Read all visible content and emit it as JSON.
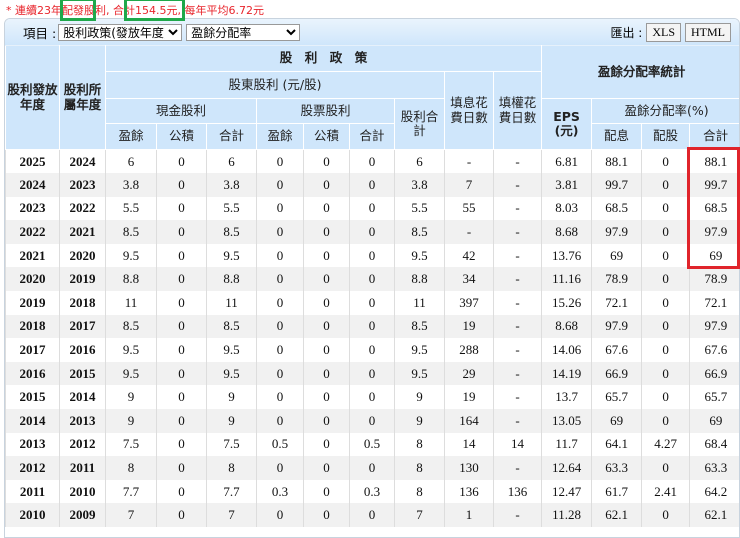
{
  "note": "* 連續23年配發股利, 合計154.5元, 每年平均6.72元",
  "toolbar": {
    "item_label": "項目 :",
    "select1": "股利政策(發放年度)",
    "select2": "盈餘分配率",
    "export_label": "匯出 :",
    "xls": "XLS",
    "html": "HTML"
  },
  "headers": {
    "pay_year": "股利發放年度",
    "belong_year": "股利所屬年度",
    "policy": "股　利　政　策",
    "holder_div": "股東股利 (元/股)",
    "cash": "現金股利",
    "stock": "股票股利",
    "earn": "盈餘",
    "reserve": "公積",
    "total": "合計",
    "div_total": "股利合計",
    "fill_div": "填息花費日數",
    "fill_right": "填權花費日數",
    "stats": "盈餘分配率統計",
    "eps": "EPS (元)",
    "ratio": "盈餘分配率(%)",
    "r_cash": "配息",
    "r_stock": "配股",
    "r_total": "合計"
  },
  "rows": [
    [
      "2025",
      "2024",
      "6",
      "0",
      "6",
      "0",
      "0",
      "0",
      "6",
      "-",
      "-",
      "6.81",
      "88.1",
      "0",
      "88.1"
    ],
    [
      "2024",
      "2023",
      "3.8",
      "0",
      "3.8",
      "0",
      "0",
      "0",
      "3.8",
      "7",
      "-",
      "3.81",
      "99.7",
      "0",
      "99.7"
    ],
    [
      "2023",
      "2022",
      "5.5",
      "0",
      "5.5",
      "0",
      "0",
      "0",
      "5.5",
      "55",
      "-",
      "8.03",
      "68.5",
      "0",
      "68.5"
    ],
    [
      "2022",
      "2021",
      "8.5",
      "0",
      "8.5",
      "0",
      "0",
      "0",
      "8.5",
      "-",
      "-",
      "8.68",
      "97.9",
      "0",
      "97.9"
    ],
    [
      "2021",
      "2020",
      "9.5",
      "0",
      "9.5",
      "0",
      "0",
      "0",
      "9.5",
      "42",
      "-",
      "13.76",
      "69",
      "0",
      "69"
    ],
    [
      "2020",
      "2019",
      "8.8",
      "0",
      "8.8",
      "0",
      "0",
      "0",
      "8.8",
      "34",
      "-",
      "11.16",
      "78.9",
      "0",
      "78.9"
    ],
    [
      "2019",
      "2018",
      "11",
      "0",
      "11",
      "0",
      "0",
      "0",
      "11",
      "397",
      "-",
      "15.26",
      "72.1",
      "0",
      "72.1"
    ],
    [
      "2018",
      "2017",
      "8.5",
      "0",
      "8.5",
      "0",
      "0",
      "0",
      "8.5",
      "19",
      "-",
      "8.68",
      "97.9",
      "0",
      "97.9"
    ],
    [
      "2017",
      "2016",
      "9.5",
      "0",
      "9.5",
      "0",
      "0",
      "0",
      "9.5",
      "288",
      "-",
      "14.06",
      "67.6",
      "0",
      "67.6"
    ],
    [
      "2016",
      "2015",
      "9.5",
      "0",
      "9.5",
      "0",
      "0",
      "0",
      "9.5",
      "29",
      "-",
      "14.19",
      "66.9",
      "0",
      "66.9"
    ],
    [
      "2015",
      "2014",
      "9",
      "0",
      "9",
      "0",
      "0",
      "0",
      "9",
      "19",
      "-",
      "13.7",
      "65.7",
      "0",
      "65.7"
    ],
    [
      "2014",
      "2013",
      "9",
      "0",
      "9",
      "0",
      "0",
      "0",
      "9",
      "164",
      "-",
      "13.05",
      "69",
      "0",
      "69"
    ],
    [
      "2013",
      "2012",
      "7.5",
      "0",
      "7.5",
      "0.5",
      "0",
      "0.5",
      "8",
      "14",
      "14",
      "11.7",
      "64.1",
      "4.27",
      "68.4"
    ],
    [
      "2012",
      "2011",
      "8",
      "0",
      "8",
      "0",
      "0",
      "0",
      "8",
      "130",
      "-",
      "12.64",
      "63.3",
      "0",
      "63.3"
    ],
    [
      "2011",
      "2010",
      "7.7",
      "0",
      "7.7",
      "0.3",
      "0",
      "0.3",
      "8",
      "136",
      "136",
      "12.47",
      "61.7",
      "2.41",
      "64.2"
    ],
    [
      "2010",
      "2009",
      "7",
      "0",
      "7",
      "0",
      "0",
      "0",
      "7",
      "1",
      "-",
      "11.28",
      "62.1",
      "0",
      "62.1"
    ]
  ]
}
